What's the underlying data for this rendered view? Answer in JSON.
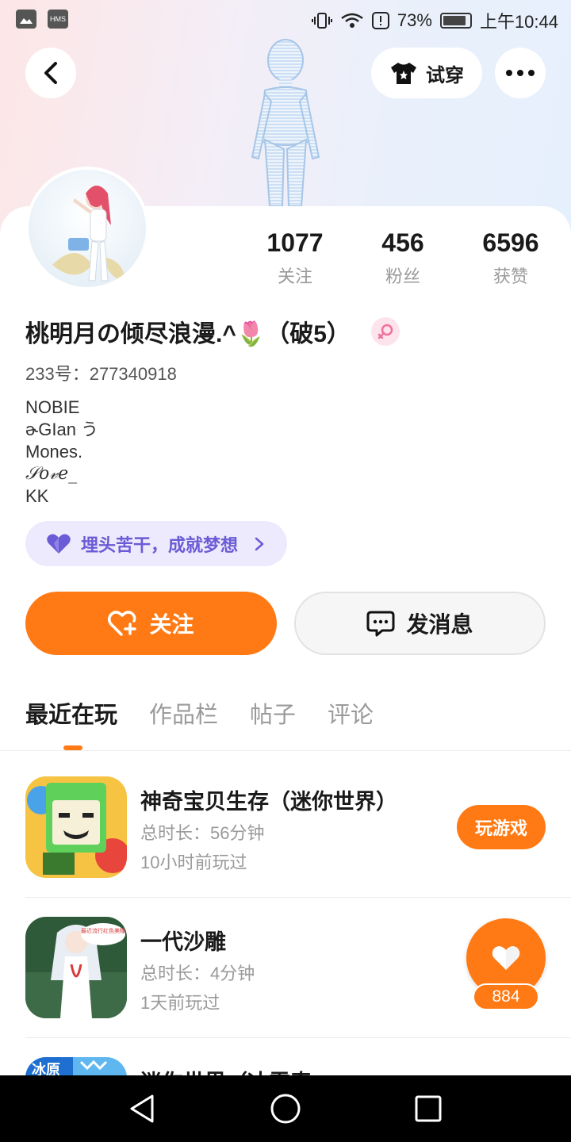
{
  "status_bar": {
    "hms_label": "HMS",
    "battery": "73%",
    "time": "上午10:44"
  },
  "header": {
    "try_on_label": "试穿"
  },
  "stats": [
    {
      "value": "1077",
      "label": "关注"
    },
    {
      "value": "456",
      "label": "粉丝"
    },
    {
      "value": "6596",
      "label": "获赞"
    }
  ],
  "profile": {
    "nickname": "桃明月の倾尽浪漫.^🌷（破5）",
    "uid": "233号：277340918",
    "bio": [
      "NOBIE",
      "ɚGIan う",
      "Mones.",
      "𝒮𝑜𝓋𝑒_",
      "KK"
    ],
    "tag": "埋头苦干，成就梦想"
  },
  "actions": {
    "follow_label": "关注",
    "message_label": "发消息"
  },
  "tabs": [
    "最近在玩",
    "作品栏",
    "帖子",
    "评论"
  ],
  "games": [
    {
      "title": "神奇宝贝生存（迷你世界）",
      "duration": "总时长：56分钟",
      "last_played": "10小时前玩过",
      "button": "玩游戏"
    },
    {
      "title": "一代沙雕",
      "duration": "总时长：4分钟",
      "last_played": "1天前玩过",
      "icon_caption": "最近流行红色美瞳"
    },
    {
      "title": "迷你世界（冰雪奇",
      "icon_caption": "冰原"
    }
  ],
  "like_float": {
    "count": "884"
  },
  "colors": {
    "accent": "#ff7a14",
    "tag_text": "#6b5bd6",
    "tag_bg": "#eceafc"
  }
}
